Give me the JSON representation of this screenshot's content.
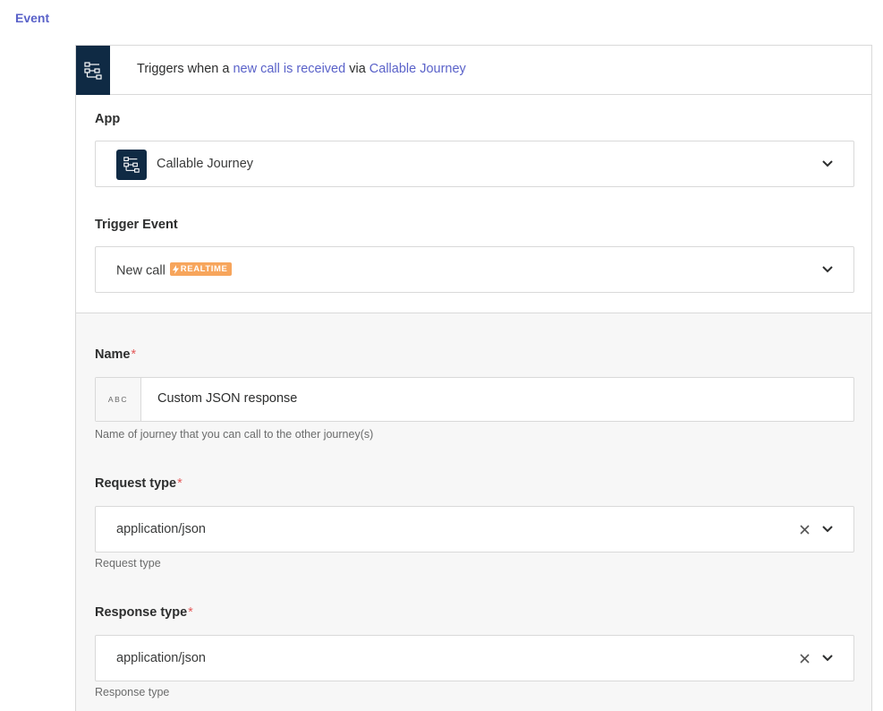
{
  "section_title": "Event",
  "header": {
    "prefix": "Triggers when a ",
    "link1": "new call is received",
    "middle": " via ",
    "link2": "Callable Journey"
  },
  "app_field": {
    "label": "App",
    "value": "Callable Journey",
    "icon": "flow-diagram-icon"
  },
  "trigger_field": {
    "label": "Trigger Event",
    "value": "New call",
    "badge": "REALTIME",
    "badge_color": "#f7a55c"
  },
  "name_field": {
    "label": "Name",
    "required_mark": "*",
    "prefix": "ABC",
    "value": "Custom JSON response",
    "help": "Name of journey that you can call to the other journey(s)"
  },
  "request_field": {
    "label": "Request type",
    "required_mark": "*",
    "value": "application/json",
    "help": "Request type"
  },
  "response_field": {
    "label": "Response type",
    "required_mark": "*",
    "value": "application/json",
    "help": "Response type"
  },
  "colors": {
    "accent": "#5a62c9",
    "icon_bg": "#0f2a44",
    "required": "#e45a5a"
  }
}
